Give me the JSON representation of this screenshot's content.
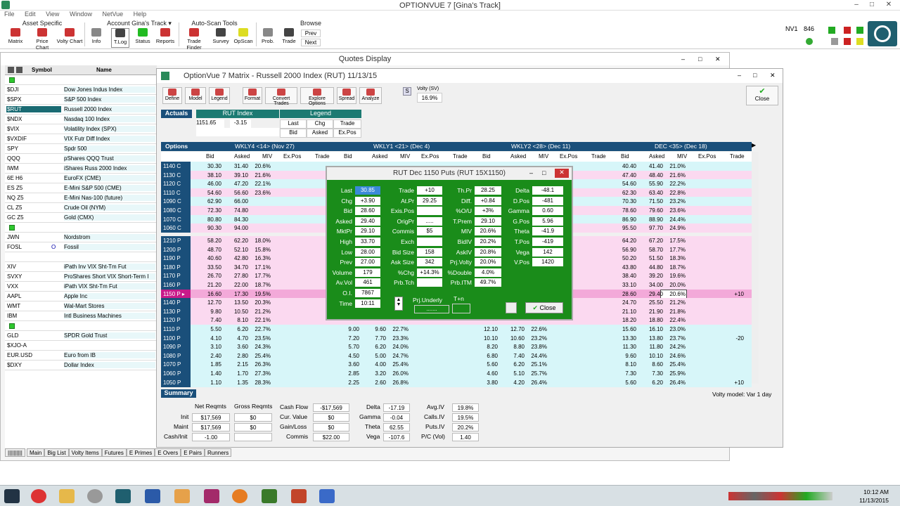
{
  "app": {
    "title": "OPTIONVUE 7   [Gina's Track]"
  },
  "menu": [
    "File",
    "Edit",
    "View",
    "Window",
    "NetVue",
    "Help"
  ],
  "toolbar": {
    "groups": [
      "Asset Specific",
      "Account Gina's Track ▾",
      "Auto-Scan Tools",
      "Browse"
    ],
    "buttons": [
      "Matrix",
      "Price Chart",
      "Volty Chart",
      "Info",
      "T.Log",
      "Status",
      "Reports",
      "Trade Finder",
      "Survey",
      "OpScan",
      "Prob.",
      "Trade"
    ],
    "browse_prev": "Prev",
    "browse_next": "Next",
    "nv": "NV1",
    "nv_count": "846"
  },
  "quotes": {
    "title": "Quotes Display",
    "col_symbol": "Symbol",
    "col_name": "Name",
    "rows": [
      {
        "s": "",
        "n": "",
        "g": true
      },
      {
        "s": "$DJI",
        "n": "Dow Jones Indus Index"
      },
      {
        "s": "$SPX",
        "n": "S&P 500 Index"
      },
      {
        "s": "$RUT",
        "n": "Russell 2000 Index",
        "sel": true
      },
      {
        "s": "$NDX",
        "n": "Nasdaq 100 Index"
      },
      {
        "s": "$VIX",
        "n": "Volatility Index (SPX)"
      },
      {
        "s": "$VXDIF",
        "n": "VIX Futr Diff Index"
      },
      {
        "s": "SPY",
        "n": "Spdr 500"
      },
      {
        "s": "QQQ",
        "n": "pShares QQQ Trust"
      },
      {
        "s": "IWM",
        "n": "iShares Russ 2000 Index"
      },
      {
        "s": "6E H6",
        "n": "EuroFX (CME)"
      },
      {
        "s": "ES Z5",
        "n": "E-Mini S&P 500 (CME)"
      },
      {
        "s": "NQ Z5",
        "n": "E-Mini Nas-100 (future)"
      },
      {
        "s": "CL Z5",
        "n": "Crude Oil (NYM)"
      },
      {
        "s": "GC Z5",
        "n": "Gold (CMX)"
      },
      {
        "s": "",
        "n": "",
        "g": true
      },
      {
        "s": "JWN",
        "n": "Nordstrom"
      },
      {
        "s": "FOSL",
        "n": "Fossil",
        "o": "O"
      },
      {
        "s": "",
        "n": ""
      },
      {
        "s": "XIV",
        "n": "iPath Inv VIX Sht-Tm Fut"
      },
      {
        "s": "SVXY",
        "n": "ProShares Short VIX Short-Term I"
      },
      {
        "s": "VXX",
        "n": "iPath VIX Sht-Tm Fut"
      },
      {
        "s": "AAPL",
        "n": "Apple Inc"
      },
      {
        "s": "WMT",
        "n": "Wal-Mart Stores"
      },
      {
        "s": "IBM",
        "n": "Intl Business Machines"
      },
      {
        "s": "",
        "n": "",
        "g": true
      },
      {
        "s": "GLD",
        "n": "SPDR Gold Trust"
      },
      {
        "s": "$XJO-A",
        "n": ""
      },
      {
        "s": "EUR.USD",
        "n": "Euro from IB"
      },
      {
        "s": "$DXY",
        "n": "Dollar Index"
      }
    ],
    "tabs": [
      "Main",
      "Big List",
      "Volty Items",
      "Futures",
      "E Primes",
      "E Overs",
      "E Pairs",
      "Runners"
    ]
  },
  "matrix": {
    "title": "OptionVue 7 Matrix - Russell 2000 Index (RUT)  11/13/15",
    "tools": [
      "Define",
      "Model",
      "Legend",
      "Format",
      "Convert Trades",
      "Explore Options",
      "Spread",
      "Analyze"
    ],
    "volty_label": "Volty (SV)",
    "volty_value": "16.9%",
    "close": "Close",
    "actuals": "Actuals",
    "rut_label": "RUT Index",
    "rut_last": "1151.65",
    "rut_chg": "-3.15",
    "legend_label": "Legend",
    "legend_items": [
      "Last",
      "Chg",
      "Trade",
      "Bid",
      "Asked",
      "Ex.Pos"
    ],
    "options_label": "Options",
    "series": [
      "WKLY4 <14> (Nov 27)",
      "WKLY1 <21> (Dec 4)",
      "WKLY2 <28> (Dec 11)",
      "DEC <35> (Dec 18)"
    ],
    "col_headers": [
      "Bid",
      "Asked",
      "MIV",
      "Ex.Pos",
      "Trade"
    ],
    "calls": [
      {
        "k": "1140 C",
        "a": [
          "30.30",
          "31.40",
          "20.6%"
        ],
        "d": [
          "40.40",
          "41.40",
          "21.0%"
        ]
      },
      {
        "k": "1130 C",
        "a": [
          "38.10",
          "39.10",
          "21.6%"
        ],
        "d": [
          "47.40",
          "48.40",
          "21.6%"
        ]
      },
      {
        "k": "1120 C",
        "a": [
          "46.00",
          "47.20",
          "22.1%"
        ],
        "d": [
          "54.60",
          "55.90",
          "22.2%"
        ]
      },
      {
        "k": "1110 C",
        "a": [
          "54.60",
          "56.60",
          "23.6%"
        ],
        "d": [
          "62.30",
          "63.40",
          "22.8%"
        ]
      },
      {
        "k": "1090 C",
        "a": [
          "62.90",
          "66.00",
          ""
        ],
        "d": [
          "70.30",
          "71.50",
          "23.2%"
        ]
      },
      {
        "k": "1080 C",
        "a": [
          "72.30",
          "74.80",
          ""
        ],
        "d": [
          "78.60",
          "79.60",
          "23.6%"
        ]
      },
      {
        "k": "1070 C",
        "a": [
          "80.80",
          "84.30",
          ""
        ],
        "d": [
          "86.90",
          "88.90",
          "24.4%"
        ]
      },
      {
        "k": "1060 C",
        "a": [
          "90.30",
          "94.00",
          ""
        ],
        "d": [
          "95.50",
          "97.70",
          "24.9%"
        ]
      }
    ],
    "puts": [
      {
        "k": "1210 P",
        "a": [
          "58.20",
          "62.20",
          "18.0%"
        ],
        "b": [],
        "c": [],
        "d": [
          "64.20",
          "67.20",
          "17.5%"
        ],
        "t": ""
      },
      {
        "k": "1200 P",
        "a": [
          "48.70",
          "52.10",
          "15.8%"
        ],
        "b": [],
        "c": [],
        "d": [
          "56.90",
          "58.70",
          "17.7%"
        ],
        "t": ""
      },
      {
        "k": "1190 P",
        "a": [
          "40.60",
          "42.80",
          "16.3%"
        ],
        "b": [],
        "c": [],
        "d": [
          "50.20",
          "51.50",
          "18.3%"
        ],
        "t": ""
      },
      {
        "k": "1180 P",
        "a": [
          "33.50",
          "34.70",
          "17.1%"
        ],
        "b": [],
        "c": [],
        "d": [
          "43.80",
          "44.80",
          "18.7%"
        ],
        "t": ""
      },
      {
        "k": "1170 P",
        "a": [
          "26.70",
          "27.80",
          "17.7%"
        ],
        "b": [],
        "c": [],
        "d": [
          "38.40",
          "39.20",
          "19.6%"
        ],
        "t": ""
      },
      {
        "k": "1160 P",
        "a": [
          "21.20",
          "22.00",
          "18.7%"
        ],
        "b": [],
        "c": [],
        "d": [
          "33.10",
          "34.00",
          "20.0%"
        ],
        "t": ""
      },
      {
        "k": "1150 P ▸",
        "a": [
          "16.60",
          "17.30",
          "19.5%"
        ],
        "b": [],
        "c": [],
        "d": [
          "28.60",
          "29.40",
          "20.6%"
        ],
        "t": "+10",
        "hl": true
      },
      {
        "k": "1140 P",
        "a": [
          "12.70",
          "13.50",
          "20.3%"
        ],
        "b": [],
        "c": [],
        "d": [
          "24.70",
          "25.50",
          "21.2%"
        ],
        "t": ""
      },
      {
        "k": "1130 P",
        "a": [
          "9.80",
          "10.50",
          "21.2%"
        ],
        "b": [],
        "c": [],
        "d": [
          "21.10",
          "21.90",
          "21.8%"
        ],
        "t": ""
      },
      {
        "k": "1120 P",
        "a": [
          "7.40",
          "8.10",
          "22.1%"
        ],
        "b": [],
        "c": [],
        "d": [
          "18.20",
          "18.80",
          "22.4%"
        ],
        "t": ""
      },
      {
        "k": "1110 P",
        "a": [
          "5.50",
          "6.20",
          "22.7%"
        ],
        "b": [
          "9.00",
          "9.60",
          "22.7%"
        ],
        "c": [
          "12.10",
          "12.70",
          "22.6%"
        ],
        "d": [
          "15.60",
          "16.10",
          "23.0%"
        ],
        "t": ""
      },
      {
        "k": "1100 P",
        "a": [
          "4.10",
          "4.70",
          "23.5%"
        ],
        "b": [
          "7.20",
          "7.70",
          "23.3%"
        ],
        "c": [
          "10.10",
          "10.60",
          "23.2%"
        ],
        "d": [
          "13.30",
          "13.80",
          "23.7%"
        ],
        "t": "-20"
      },
      {
        "k": "1090 P",
        "a": [
          "3.10",
          "3.60",
          "24.3%"
        ],
        "b": [
          "5.70",
          "6.20",
          "24.0%"
        ],
        "c": [
          "8.20",
          "8.80",
          "23.8%"
        ],
        "d": [
          "11.30",
          "11.80",
          "24.2%"
        ],
        "t": ""
      },
      {
        "k": "1080 P",
        "a": [
          "2.40",
          "2.80",
          "25.4%"
        ],
        "b": [
          "4.50",
          "5.00",
          "24.7%"
        ],
        "c": [
          "6.80",
          "7.40",
          "24.4%"
        ],
        "d": [
          "9.60",
          "10.10",
          "24.6%"
        ],
        "t": ""
      },
      {
        "k": "1070 P",
        "a": [
          "1.85",
          "2.15",
          "26.3%"
        ],
        "b": [
          "3.60",
          "4.00",
          "25.4%"
        ],
        "c": [
          "5.60",
          "6.20",
          "25.1%"
        ],
        "d": [
          "8.10",
          "8.60",
          "25.4%"
        ],
        "t": ""
      },
      {
        "k": "1060 P",
        "a": [
          "1.40",
          "1.70",
          "27.3%"
        ],
        "b": [
          "2.85",
          "3.20",
          "26.0%"
        ],
        "c": [
          "4.60",
          "5.10",
          "25.7%"
        ],
        "d": [
          "7.30",
          "7.30",
          "25.9%"
        ],
        "t": ""
      },
      {
        "k": "1050 P",
        "a": [
          "1.10",
          "1.35",
          "28.3%"
        ],
        "b": [
          "2.25",
          "2.60",
          "26.8%"
        ],
        "c": [
          "3.80",
          "4.20",
          "26.4%"
        ],
        "d": [
          "5.60",
          "6.20",
          "26.4%"
        ],
        "t": "+10"
      }
    ],
    "summary": {
      "label": "Summary",
      "net_reqmts": "Net Reqmts",
      "gross_reqmts": "Gross Reqmts",
      "init_label": "Init",
      "init_net": "$17,569",
      "init_gross": "$0",
      "maint_label": "Maint",
      "maint_net": "$17,569",
      "maint_gross": "$0",
      "cashinit_label": "Cash/Init",
      "cashinit_net": "-1.00",
      "cash_flow_label": "Cash Flow",
      "cash_flow": "-$17,569",
      "cur_value_label": "Cur. Value",
      "cur_value": "$0",
      "gainloss_label": "Gain/Loss",
      "gainloss": "$0",
      "commis_label": "Commis",
      "commis": "$22.00",
      "delta_label": "Delta",
      "delta": "-17.19",
      "gamma_label": "Gamma",
      "gamma": "-0.04",
      "theta_label": "Theta",
      "theta": "62.55",
      "vega_label": "Vega",
      "vega": "-107.6",
      "avgiv_label": "Avg.IV",
      "avgiv": "19.8%",
      "callsiv_label": "Calls.IV",
      "callsiv": "19.5%",
      "putsiv_label": "Puts.IV",
      "putsiv": "20.2%",
      "pcvol_label": "P/C (Vol)",
      "pcvol": "1.40",
      "volty_model": "Volty model: Var 1 day"
    }
  },
  "dialog": {
    "title": "RUT Dec 1150 Puts   (RUT 15X1150)",
    "col1": [
      [
        "Last",
        "30.85"
      ],
      [
        "Chg",
        "+3.90"
      ],
      [
        "Bid",
        "28.60"
      ],
      [
        "Asked",
        "29.40"
      ],
      [
        "MktPr",
        "29.10"
      ],
      [
        "High",
        "33.70"
      ],
      [
        "Low",
        "28.00"
      ],
      [
        "Prev",
        "27.00"
      ],
      [
        "Volume",
        "179"
      ],
      [
        "Av.Vol",
        "461"
      ],
      [
        "O.I.",
        "7867"
      ],
      [
        "Time",
        "10:11"
      ]
    ],
    "col2": [
      [
        "Trade",
        "+10"
      ],
      [
        "At.Pr",
        "29.25"
      ],
      [
        "Exis.Pos",
        ""
      ],
      [
        "OrigPr",
        "....."
      ],
      [
        "Commis",
        "$5"
      ],
      [
        "Exch",
        ""
      ],
      [
        "Bid Size",
        "158"
      ],
      [
        "Ask Size",
        "342"
      ],
      [
        "%Chg",
        "+14.3%"
      ],
      [
        "Prb.Tch",
        ""
      ]
    ],
    "col3": [
      [
        "Th.Pr",
        "28.25"
      ],
      [
        "Diff.",
        "+0.84"
      ],
      [
        "%O/U",
        "+3%"
      ],
      [
        "T.Prem",
        "29.10"
      ],
      [
        "MIV",
        "20.6%"
      ],
      [
        "BidIV",
        "20.2%"
      ],
      [
        "AskIV",
        "20.8%"
      ],
      [
        "Prj.Volty",
        "20.0%"
      ],
      [
        "%Double",
        "4.0%"
      ],
      [
        "Prb.ITM",
        "49.7%"
      ]
    ],
    "col4": [
      [
        "Delta",
        "-48.1"
      ],
      [
        "D.Pos",
        "-481"
      ],
      [
        "Gamma",
        "0.60"
      ],
      [
        "G.Pos",
        "5.96"
      ],
      [
        "Theta",
        "-41.9"
      ],
      [
        "T.Pos",
        "-419"
      ],
      [
        "Vega",
        "142"
      ],
      [
        "V.Pos",
        "1420"
      ]
    ],
    "prj_underly": "Prj.Underly",
    "tn": "T+n",
    "close": "Close"
  },
  "clock": {
    "time": "10:12 AM",
    "date": "11/13/2015"
  }
}
